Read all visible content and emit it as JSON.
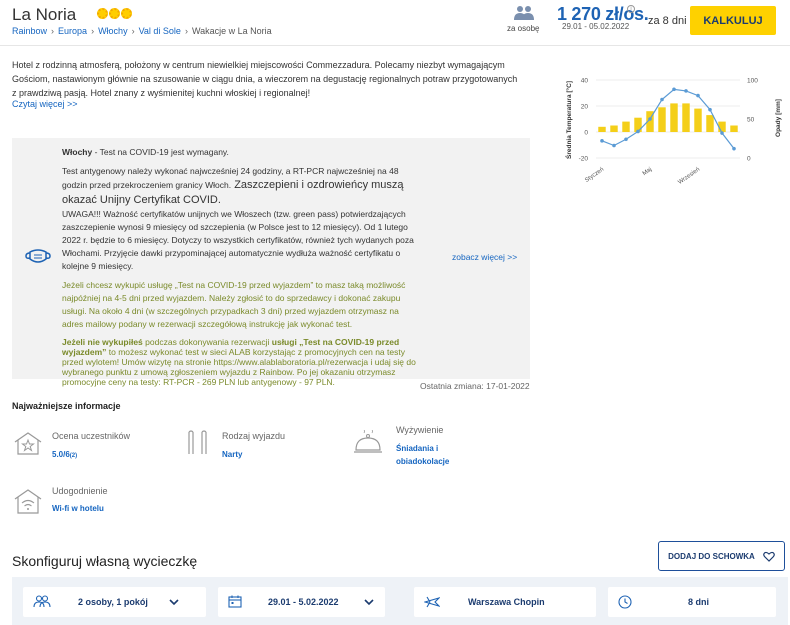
{
  "header": {
    "title": "La Noria",
    "breadcrumb": [
      "Rainbow",
      "Europa",
      "Włochy",
      "Val di Sole",
      "Wakacje w La Noria"
    ],
    "persons_label": "za osobę",
    "price": "1 270 zł/os.",
    "price_info": "i",
    "dates": "29.01 - 05.02.2022",
    "days": "za 8 dni",
    "calc_button": "KALKULUJ"
  },
  "description": {
    "text": "Hotel z rodzinną atmosferą, położony w centrum niewielkiej miejscowości Commezzadura. Polecamy niezbyt wymagającym Gościom, nastawionym głównie na szusowanie w ciągu dnia, a wieczorem na degustację regionalnych potraw przygotowanych z prawdziwą pasją. Hotel znany z wyśmienitej kuchni włoskiej i regionalnej!",
    "read_more": "Czytaj więcej >>"
  },
  "covid": {
    "country": "Włochy",
    "headline": " - Test na COVID-19 jest wymagany.",
    "p1": "Test antygenowy należy wykonać najwcześniej 24 godziny, a RT-PCR najwcześniej na 48 godzin przed przekroczeniem granicy Włoch.",
    "p1_big": " Zaszczepieni i ozdrowieńcy muszą okazać Unijny Certyfikat COVID.",
    "p2": "UWAGA!!! Ważność certyfikatów unijnych we Włoszech (tzw. green pass) potwierdzających zaszczepienie wynosi 9 miesięcy od szczepienia (w Polsce jest to 12 miesięcy). Od 1 lutego 2022 r. będzie to 6 miesięcy. Dotyczy to wszystkich certyfikatów, również tych wydanych poza Włochami. Przyjęcie dawki przypominającej automatycznie wydłuża ważność certyfikatu o kolejne 9 miesięcy.",
    "p3": "Jeżeli chcesz wykupić usługę „Test na COVID-19 przed wyjazdem” to masz taką możliwość najpóźniej na 4-5 dni przed wyjazdem. Należy zgłosić to do sprzedawcy i dokonać zakupu usługi. Na około 4 dni (w szczególnych przypadkach 3 dni) przed wyjazdem otrzymasz na adres mailowy podany w rezerwacji szczegółową instrukcję jak wykonać test.",
    "p4_bold": "Jeżeli nie wykupiłeś",
    "p4_a": " podczas dokonywania rezerwacji ",
    "p4_bold2": "usługi „Test na COVID-19 przed wyjazdem”",
    "p4_b": " to możesz wykonać test w sieci ALAB korzystając z promocyjnych cen na testy przed wylotem! Umów wizytę na stronie https://www.alablaboratoria.pl/rezerwacja i udaj się do wybranego punktu z umową zgłoszeniem wyjazdu z Rainbow. Po jej okazaniu otrzymasz promocyjne ceny na testy: RT-PCR - 269 PLN lub antygenowy - 97 PLN.",
    "more_link": "zobacz więcej >>",
    "last_change": "Ostatnia zmiana: 17-01-2022"
  },
  "chart_data": {
    "type": "bar",
    "title": "",
    "ylabel": "Średnia Temperatura [°C]",
    "y2label": "Opady [mm]",
    "ylim": [
      -20,
      40
    ],
    "y2lim": [
      0,
      100
    ],
    "yticks": [
      -20,
      0,
      20,
      40
    ],
    "y2ticks": [
      0,
      50,
      100
    ],
    "xticks": [
      "Styczeń",
      "Maj",
      "Wrzesień"
    ],
    "series": [
      {
        "type": "bar",
        "axis": "y",
        "values": [
          4,
          5,
          8,
          11,
          16,
          19,
          22,
          22,
          18,
          13,
          8,
          5
        ]
      },
      {
        "type": "line",
        "axis": "y2",
        "values": [
          22,
          16,
          24,
          34,
          50,
          75,
          88,
          86,
          80,
          62,
          32,
          12
        ]
      }
    ],
    "colors": {
      "bars": "#f4cf19",
      "line": "#5b9bd5"
    }
  },
  "info": {
    "title": "Najważniejsze informacje",
    "rating_label": "Ocena uczestników",
    "rating_value": "5.0/6",
    "rating_count": "(2)",
    "trip_label": "Rodzaj wyjazdu",
    "trip_value": "Narty",
    "food_label": "Wyżywienie",
    "food_value1": "Śniadania i",
    "food_value2": "obiadokolacje",
    "facility_label": "Udogodnienie",
    "facility_value": "Wi-fi w hotelu"
  },
  "configure": {
    "title": "Skonfiguruj własną wycieczkę",
    "clipboard_button": "DODAJ DO SCHOWKA",
    "persons": "2 osoby, 1 pokój",
    "dates": "29.01 - 5.02.2022",
    "airport": "Warszawa Chopin",
    "duration": "8 dni"
  }
}
